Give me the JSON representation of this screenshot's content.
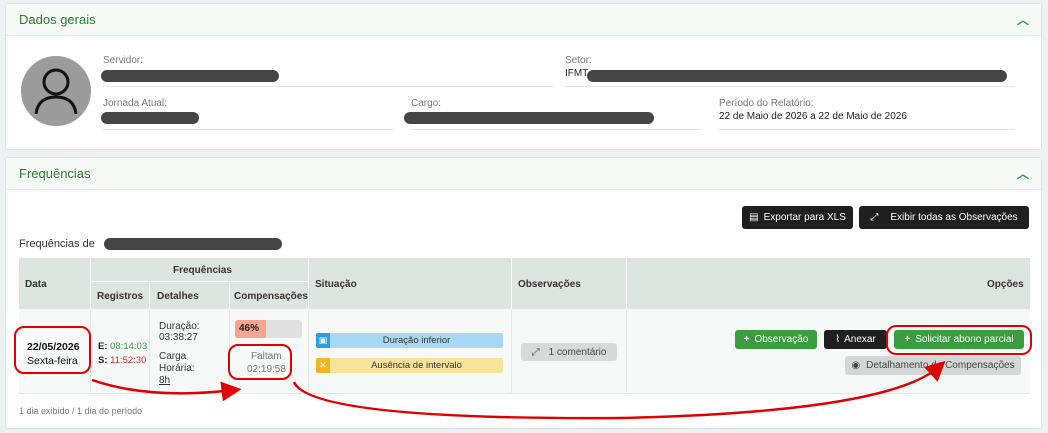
{
  "dados_gerais": {
    "title": "Dados gerais",
    "servidor_label": "Servidor:",
    "setor_label": "Setor:",
    "setor_value": "IFMT",
    "jornada_label": "Jornada Atual:",
    "cargo_label": "Cargo:",
    "periodo_label": "Período do Relatório:",
    "periodo_value": "22 de Maio de 2026 a 22 de Maio de 2026"
  },
  "frequencias": {
    "title": "Frequências",
    "export_label": "Exportar para XLS",
    "show_obs_label": "Exibir todas as Observações",
    "freq_de_label": "Frequências de",
    "headers": {
      "data": "Data",
      "frequencias": "Frequências",
      "registros": "Registros",
      "detalhes": "Detalhes",
      "compensacoes": "Compensações",
      "situacao": "Situação",
      "observacoes": "Observações",
      "opcoes": "Opções"
    },
    "row": {
      "date": "22/05/2026",
      "weekday": "Sexta-feira",
      "entrada_label": "E:",
      "entrada_value": "08:14:03",
      "saida_label": "S:",
      "saida_value": "11:52:30",
      "duracao_label": "Duração:",
      "duracao_value": "03:38:27",
      "carga_label": "Carga Horária:",
      "carga_value": "8h",
      "progress_label": "46%",
      "progress_fraction": 0.46,
      "faltam_label": "Faltam",
      "faltam_value": "02:19:58",
      "situacao_1": "Duração inferior",
      "situacao_2": "Ausência de intervalo",
      "comments_label": "1 comentário",
      "observacao_btn": "Observação",
      "anexar_btn": "Anexar",
      "abono_btn": "Solicitar abono parcial",
      "detalhamento_btn": "Detalhamento de Compensações"
    },
    "footer": "1 dia exibido / 1 dia do período"
  },
  "colors": {
    "header_green": "#2e7d32",
    "accent_green": "#3a9d3e",
    "annotation_red": "#e00000",
    "badge_blue": "#a9d8f5",
    "badge_yellow": "#f8e39a"
  }
}
